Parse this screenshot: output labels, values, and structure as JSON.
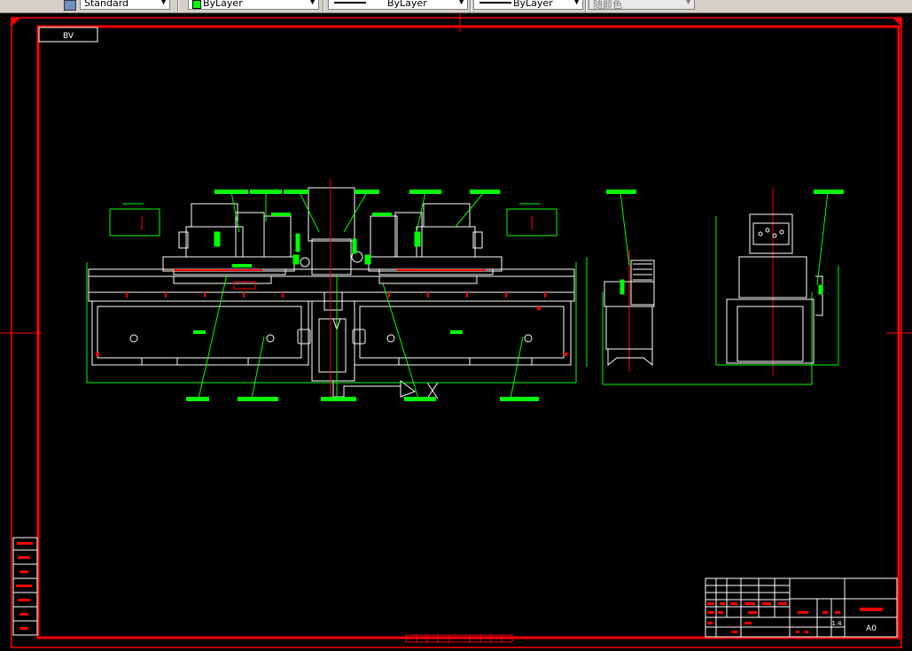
{
  "toolbar": {
    "textstyle": "Standard",
    "layer_color": "ByLayer",
    "linetype": "ByLayer",
    "lineweight": "ByLayer",
    "plotstyle": "随颜色"
  },
  "drawing": {
    "view_label": "BV",
    "sheet_size": "A0",
    "scale": "1:4",
    "title": "机床总装图",
    "frame_color": "#ff0000",
    "geometry_color": "#ffffff",
    "annotation_color": "#00ff00",
    "centerline_color": "#ff0000"
  }
}
